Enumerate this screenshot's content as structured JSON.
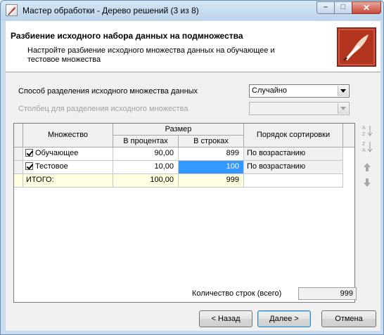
{
  "window": {
    "title": "Мастер обработки - Дерево решений (3 из 8)",
    "controls": {
      "min": "–",
      "max": "□",
      "close": "✕"
    }
  },
  "header": {
    "title": "Разбиение исходного набора данных на подмножества",
    "description": "Настройте разбиение исходного множества данных на обучающее и тестовое множества"
  },
  "form": {
    "split_method_label": "Способ разделения исходного множества данных",
    "split_method_value": "Случайно",
    "split_column_label": "Столбец для разделения исходного множества",
    "split_column_value": ""
  },
  "grid": {
    "headers": {
      "set": "Множество",
      "size": "Размер",
      "percent": "В процентах",
      "rows": "В строках",
      "sort_order": "Порядок сортировки"
    },
    "rows": [
      {
        "name": "Обучающее",
        "checked": true,
        "percent": "90,00",
        "rows": "899",
        "sort": "По возрастанию"
      },
      {
        "name": "Тестовое",
        "checked": true,
        "percent": "10,00",
        "rows": "100",
        "sort": "По возрастанию"
      }
    ],
    "total": {
      "name": "ИТОГО:",
      "percent": "100,00",
      "rows": "999",
      "sort": ""
    }
  },
  "side_tools": {
    "sort_asc_icon": "sort-ascending-icon",
    "sort_desc_icon": "sort-descending-icon",
    "move_up_icon": "arrow-up-icon",
    "move_down_icon": "arrow-down-icon"
  },
  "footer": {
    "count_label": "Количество строк (всего)",
    "count_value": "999",
    "back_button": "< Назад",
    "next_button": "Далее >",
    "cancel_button": "Отмена"
  },
  "colors": {
    "selection": "#3399ff",
    "total_row": "#ffffe1",
    "logo": "#a72c18"
  }
}
